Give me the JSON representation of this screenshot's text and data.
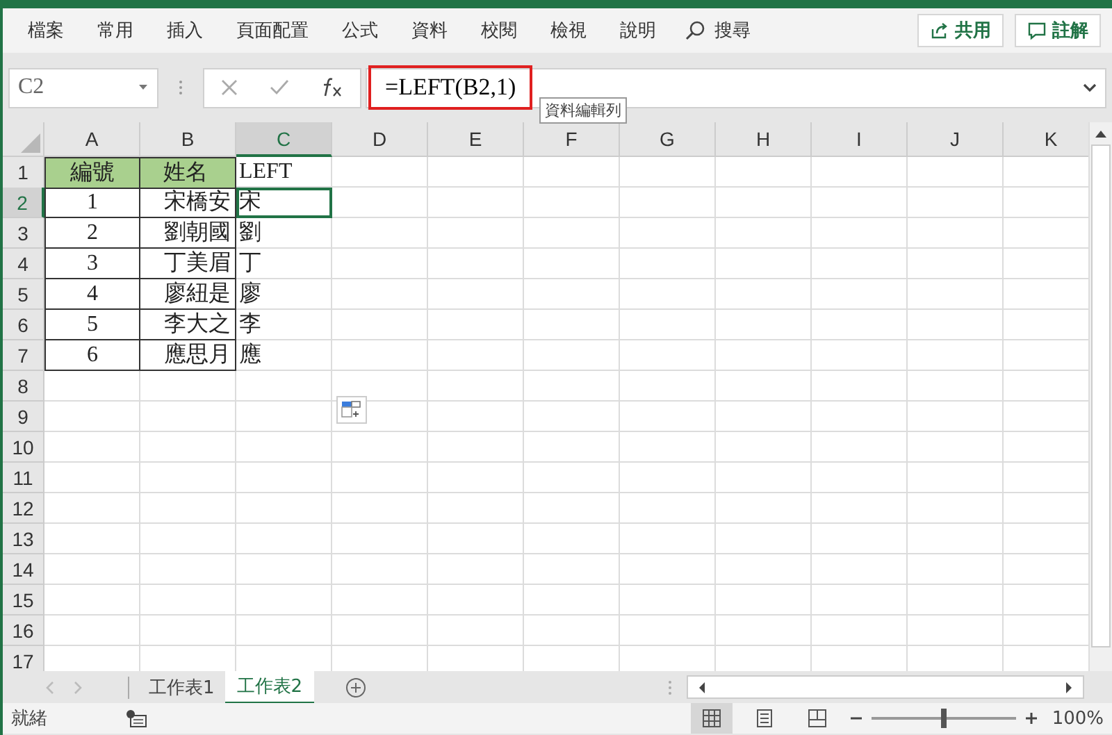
{
  "ribbon": {
    "tabs": [
      "檔案",
      "常用",
      "插入",
      "頁面配置",
      "公式",
      "資料",
      "校閱",
      "檢視",
      "說明"
    ],
    "search": "搜尋",
    "share": "共用",
    "comments": "註解"
  },
  "formula_bar": {
    "name_box": "C2",
    "formula": "=LEFT(B2,1)",
    "tooltip": "資料編輯列"
  },
  "columns": [
    {
      "label": "A",
      "selected": false
    },
    {
      "label": "B",
      "selected": false
    },
    {
      "label": "C",
      "selected": true
    },
    {
      "label": "D",
      "selected": false
    },
    {
      "label": "E",
      "selected": false
    },
    {
      "label": "F",
      "selected": false
    },
    {
      "label": "G",
      "selected": false
    },
    {
      "label": "H",
      "selected": false
    },
    {
      "label": "I",
      "selected": false
    },
    {
      "label": "J",
      "selected": false
    },
    {
      "label": "K",
      "selected": false
    }
  ],
  "rows": [
    {
      "label": "1",
      "kind": "header",
      "selected": false,
      "cells": [
        "編號",
        "姓名",
        "LEFT"
      ]
    },
    {
      "label": "2",
      "kind": "data",
      "selected": true,
      "cells": [
        "1",
        "宋橋安",
        "宋"
      ]
    },
    {
      "label": "3",
      "kind": "data",
      "selected": false,
      "cells": [
        "2",
        "劉朝國",
        "劉"
      ]
    },
    {
      "label": "4",
      "kind": "data",
      "selected": false,
      "cells": [
        "3",
        "丁美眉",
        "丁"
      ]
    },
    {
      "label": "5",
      "kind": "data",
      "selected": false,
      "cells": [
        "4",
        "廖紐是",
        "廖"
      ]
    },
    {
      "label": "6",
      "kind": "data",
      "selected": false,
      "cells": [
        "5",
        "李大之",
        "李"
      ]
    },
    {
      "label": "7",
      "kind": "data",
      "selected": false,
      "cells": [
        "6",
        "應思月",
        "應"
      ]
    },
    {
      "label": "8",
      "kind": "empty",
      "selected": false
    },
    {
      "label": "9",
      "kind": "empty",
      "selected": false
    },
    {
      "label": "10",
      "kind": "empty",
      "selected": false
    },
    {
      "label": "11",
      "kind": "empty",
      "selected": false
    },
    {
      "label": "12",
      "kind": "empty",
      "selected": false
    },
    {
      "label": "13",
      "kind": "empty",
      "selected": false
    },
    {
      "label": "14",
      "kind": "empty",
      "selected": false
    },
    {
      "label": "15",
      "kind": "empty",
      "selected": false
    },
    {
      "label": "16",
      "kind": "empty",
      "selected": false
    },
    {
      "label": "17",
      "kind": "empty",
      "selected": false
    }
  ],
  "sheets": [
    {
      "label": "工作表1",
      "selected": false
    },
    {
      "label": "工作表2",
      "selected": true
    }
  ],
  "status_bar": {
    "status": "就緒",
    "zoom": {
      "level": 0.5,
      "reading": "100%"
    }
  }
}
